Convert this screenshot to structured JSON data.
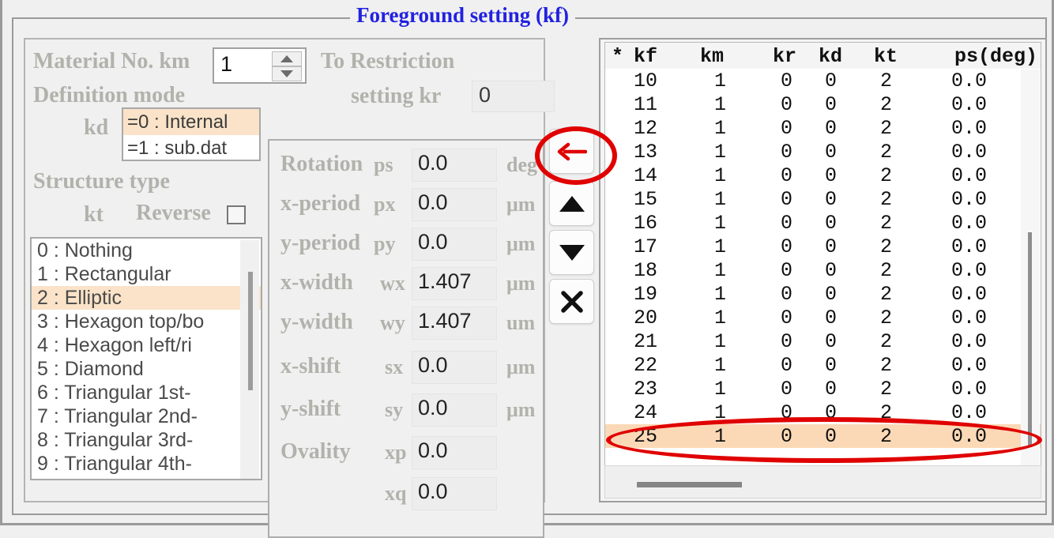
{
  "window": {
    "legend": "Foreground setting (kf)"
  },
  "left_panel": {
    "material_label": "Material No.  km",
    "material_value": "1",
    "restriction_line1": "To Restriction",
    "restriction_line2": "setting  kr",
    "kr_value": "0",
    "definition_mode_label": "Definition mode",
    "kd_label": "kd",
    "kd_options": [
      {
        "label": "=0 : Internal",
        "selected": true
      },
      {
        "label": "=1 : sub.dat",
        "selected": false
      }
    ],
    "structure_type_label": "Structure type",
    "kt_label": "kt",
    "reverse_label": "Reverse",
    "reverse_checked": false,
    "structure_list": [
      {
        "label": "0 : Nothing",
        "selected": false
      },
      {
        "label": "1 : Rectangular",
        "selected": false
      },
      {
        "label": "2 : Elliptic",
        "selected": true
      },
      {
        "label": "3 : Hexagon top/bo",
        "selected": false
      },
      {
        "label": "4 : Hexagon left/ri",
        "selected": false
      },
      {
        "label": "5 : Diamond",
        "selected": false
      },
      {
        "label": "6 : Triangular 1st-",
        "selected": false
      },
      {
        "label": "7 : Triangular 2nd-",
        "selected": false
      },
      {
        "label": "8 : Triangular 3rd-",
        "selected": false
      },
      {
        "label": "9 : Triangular 4th-",
        "selected": false
      }
    ]
  },
  "params": [
    {
      "name": "Rotation",
      "symbol": "ps",
      "value": "0.0",
      "unit": "deg"
    },
    {
      "name": "x-period",
      "symbol": "px",
      "value": "0.0",
      "unit": "μm"
    },
    {
      "name": "y-period",
      "symbol": "py",
      "value": "0.0",
      "unit": "μm"
    },
    {
      "name": "x-width",
      "symbol": "wx",
      "value": "1.407",
      "unit": "μm"
    },
    {
      "name": "y-width",
      "symbol": "wy",
      "value": "1.407",
      "unit": "um"
    },
    {
      "name": "x-shift",
      "symbol": "sx",
      "value": "0.0",
      "unit": "μm"
    },
    {
      "name": "y-shift",
      "symbol": "sy",
      "value": "0.0",
      "unit": "μm"
    },
    {
      "name": "Ovality",
      "symbol": "xp",
      "value": "0.0",
      "unit": ""
    },
    {
      "name": "",
      "symbol": "xq",
      "value": "0.0",
      "unit": ""
    }
  ],
  "side_buttons": [
    {
      "icon": "left-arrow-icon",
      "color": "#e00000",
      "highlighted": true
    },
    {
      "icon": "up-triangle-icon",
      "color": "#111111",
      "highlighted": false
    },
    {
      "icon": "down-triangle-icon",
      "color": "#111111",
      "highlighted": false
    },
    {
      "icon": "close-x-icon",
      "color": "#111111",
      "highlighted": false
    }
  ],
  "table": {
    "headers": [
      "*",
      "kf",
      "km",
      "kr",
      "kd",
      "kt",
      "ps(deg)"
    ],
    "rows": [
      {
        "kf": "10",
        "km": "1",
        "kr": "0",
        "kd": "0",
        "kt": "2",
        "ps": "0.0",
        "selected": false
      },
      {
        "kf": "11",
        "km": "1",
        "kr": "0",
        "kd": "0",
        "kt": "2",
        "ps": "0.0",
        "selected": false
      },
      {
        "kf": "12",
        "km": "1",
        "kr": "0",
        "kd": "0",
        "kt": "2",
        "ps": "0.0",
        "selected": false
      },
      {
        "kf": "13",
        "km": "1",
        "kr": "0",
        "kd": "0",
        "kt": "2",
        "ps": "0.0",
        "selected": false
      },
      {
        "kf": "14",
        "km": "1",
        "kr": "0",
        "kd": "0",
        "kt": "2",
        "ps": "0.0",
        "selected": false
      },
      {
        "kf": "15",
        "km": "1",
        "kr": "0",
        "kd": "0",
        "kt": "2",
        "ps": "0.0",
        "selected": false
      },
      {
        "kf": "16",
        "km": "1",
        "kr": "0",
        "kd": "0",
        "kt": "2",
        "ps": "0.0",
        "selected": false
      },
      {
        "kf": "17",
        "km": "1",
        "kr": "0",
        "kd": "0",
        "kt": "2",
        "ps": "0.0",
        "selected": false
      },
      {
        "kf": "18",
        "km": "1",
        "kr": "0",
        "kd": "0",
        "kt": "2",
        "ps": "0.0",
        "selected": false
      },
      {
        "kf": "19",
        "km": "1",
        "kr": "0",
        "kd": "0",
        "kt": "2",
        "ps": "0.0",
        "selected": false
      },
      {
        "kf": "20",
        "km": "1",
        "kr": "0",
        "kd": "0",
        "kt": "2",
        "ps": "0.0",
        "selected": false
      },
      {
        "kf": "21",
        "km": "1",
        "kr": "0",
        "kd": "0",
        "kt": "2",
        "ps": "0.0",
        "selected": false
      },
      {
        "kf": "22",
        "km": "1",
        "kr": "0",
        "kd": "0",
        "kt": "2",
        "ps": "0.0",
        "selected": false
      },
      {
        "kf": "23",
        "km": "1",
        "kr": "0",
        "kd": "0",
        "kt": "2",
        "ps": "0.0",
        "selected": false
      },
      {
        "kf": "24",
        "km": "1",
        "kr": "0",
        "kd": "0",
        "kt": "2",
        "ps": "0.0",
        "selected": false
      },
      {
        "kf": "25",
        "km": "1",
        "kr": "0",
        "kd": "0",
        "kt": "2",
        "ps": "0.0",
        "selected": true
      }
    ]
  },
  "colors": {
    "legend_blue": "#2222e0",
    "selection_peach": "#fae3c8",
    "row_selection_peach": "#fbd9b6",
    "annotation_red": "#e00000",
    "label_gray": "#b2b2ac"
  }
}
